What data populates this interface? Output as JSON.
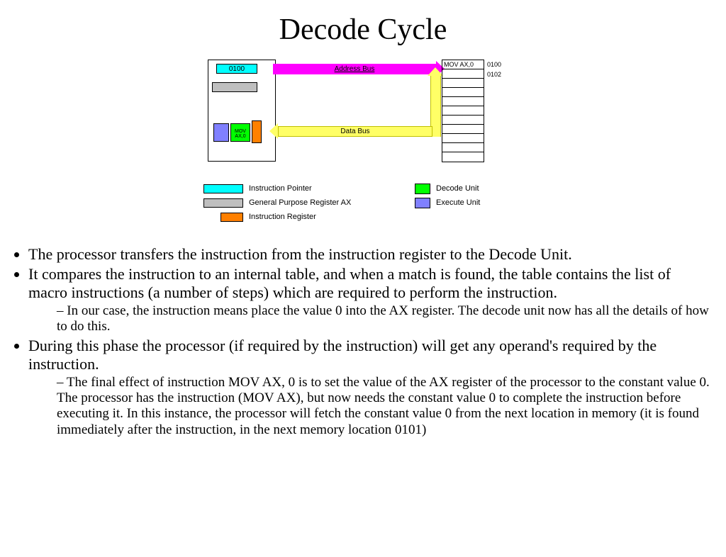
{
  "title": "Decode Cycle",
  "diagram": {
    "ip_value": "0100",
    "decode_label": "MOV AX,0",
    "address_bus_label": "Address Bus",
    "data_bus_label": "Data Bus",
    "memory_rows": [
      "MOV AX,0",
      "",
      "",
      "",
      "",
      "",
      "",
      "",
      "",
      "",
      ""
    ],
    "addresses": [
      "0100",
      "0102"
    ]
  },
  "legend": {
    "ip": "Instruction Pointer",
    "ax": "General Purpose Register AX",
    "ir": "Instruction Register",
    "decode": "Decode Unit",
    "execute": "Execute Unit"
  },
  "colors": {
    "ip": "#00ffff",
    "ax": "#bfbfbf",
    "ir": "#ff8000",
    "decode": "#00ff00",
    "execute": "#8080ff",
    "addr_bus": "#ff00ff",
    "data_bus": "#ffff66"
  },
  "bullets": [
    {
      "text": "The processor transfers the instruction from the instruction register to the Decode Unit."
    },
    {
      "text": "It compares the instruction to an internal table, and when a match is found, the table contains the list of macro instructions (a number of steps) which are required to perform the instruction.",
      "sub": [
        "In our case, the instruction means place the value 0 into the AX register. The decode unit now has all the details of how to do this."
      ]
    },
    {
      "text": "During this phase the processor (if required by the instruction) will get any operand's required by the instruction.",
      "sub": [
        "The final effect of instruction MOV AX, 0 is to set the value of the AX register of the processor to the constant value 0. The processor has the instruction (MOV AX), but now needs the constant value 0 to complete the instruction before executing it. In this instance, the processor will fetch the constant value 0 from the next location in memory (it is found immediately after the instruction, in the next memory location 0101)"
      ]
    }
  ]
}
